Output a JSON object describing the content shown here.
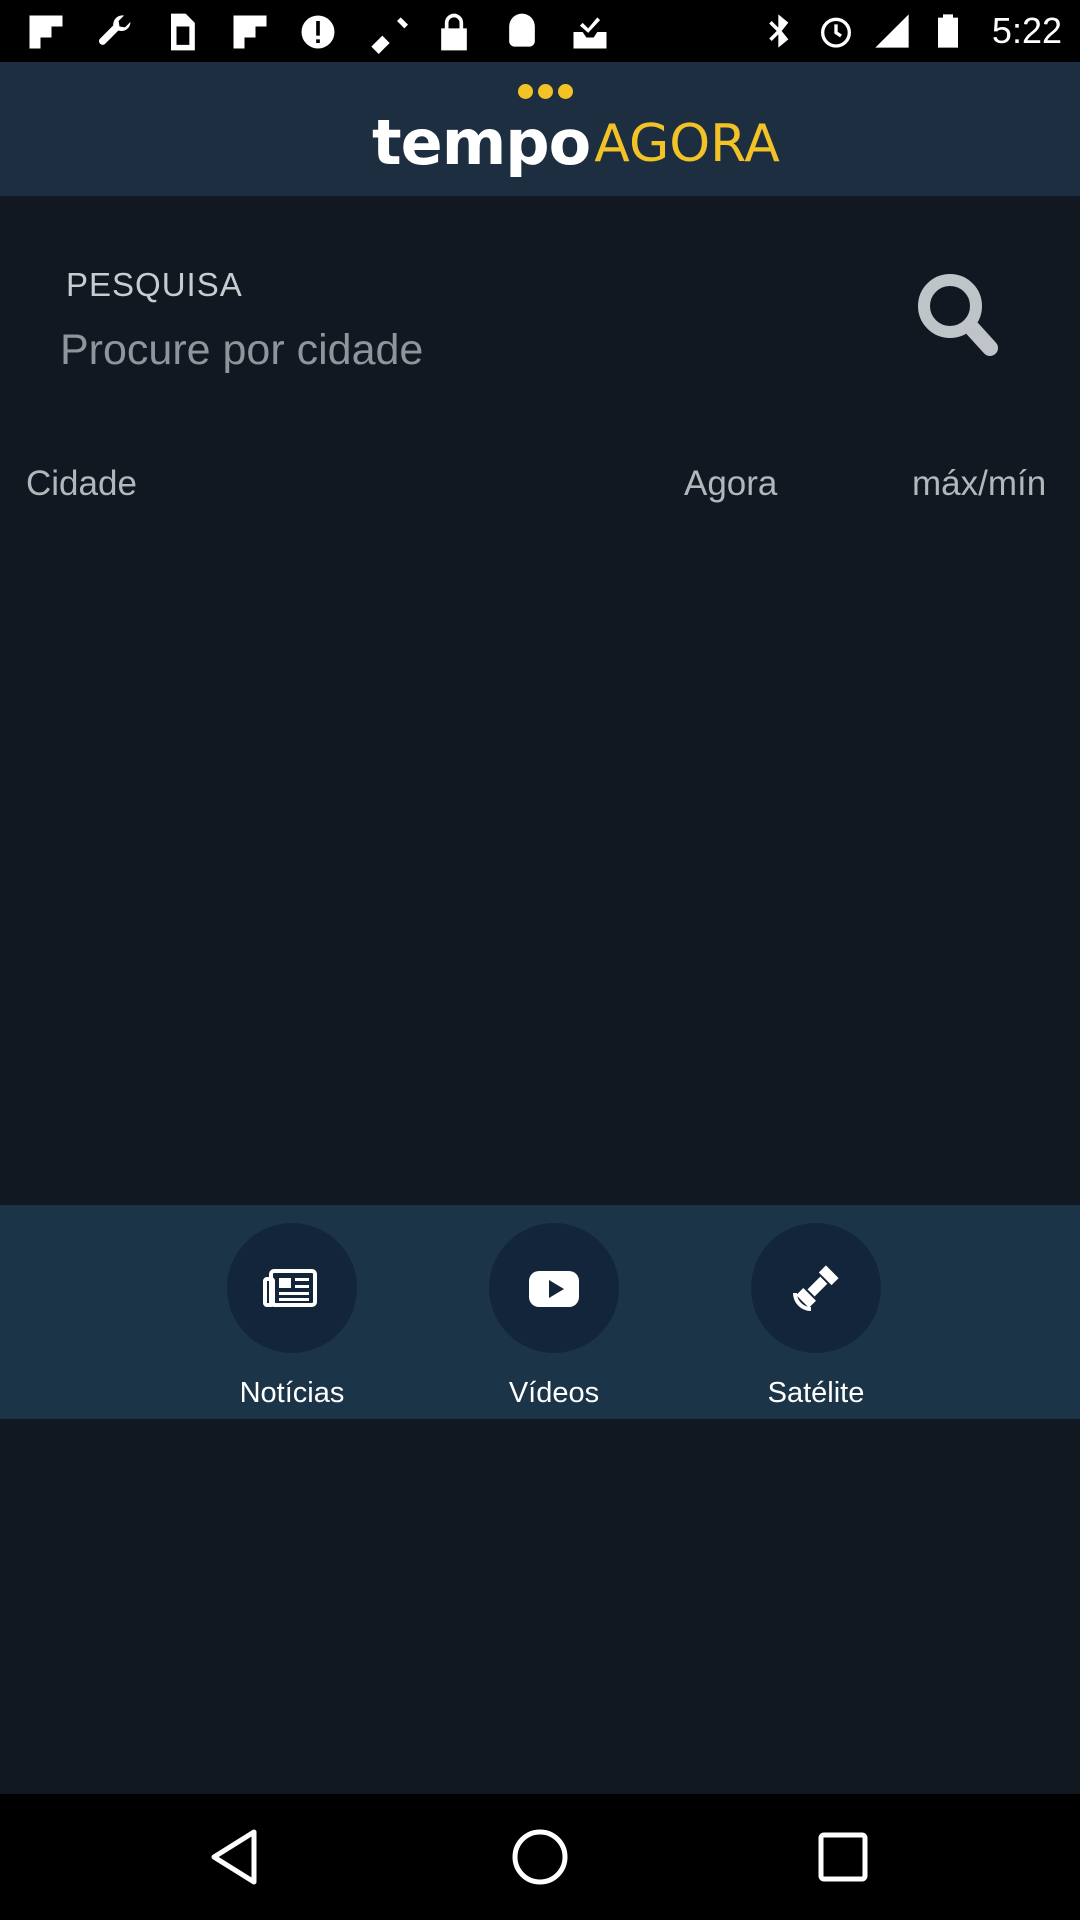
{
  "status_bar": {
    "time": "5:22",
    "left_icons": [
      "flipboard-icon",
      "wrench-icon",
      "sim-card-icon",
      "flipboard-icon",
      "info-icon",
      "fake-gps-icon",
      "lock-icon",
      "android-icon",
      "check-tray-icon"
    ],
    "right_icons": [
      "bluetooth-icon",
      "alarm-icon",
      "signal-icon",
      "battery-icon"
    ]
  },
  "header": {
    "logo_part1": "tempo",
    "logo_part2": "AGORA",
    "accent_color": "#f2c227"
  },
  "search": {
    "label": "PESQUISA",
    "placeholder": "Procure por cidade",
    "value": ""
  },
  "columns": {
    "city": "Cidade",
    "now": "Agora",
    "maxmin": "máx/mín"
  },
  "bottom_nav": {
    "items": [
      {
        "label": "Notícias",
        "icon": "newspaper-icon"
      },
      {
        "label": "Vídeos",
        "icon": "youtube-play-icon"
      },
      {
        "label": "Satélite",
        "icon": "satellite-icon"
      }
    ]
  },
  "system_nav": [
    "back-button",
    "home-button",
    "recents-button"
  ]
}
